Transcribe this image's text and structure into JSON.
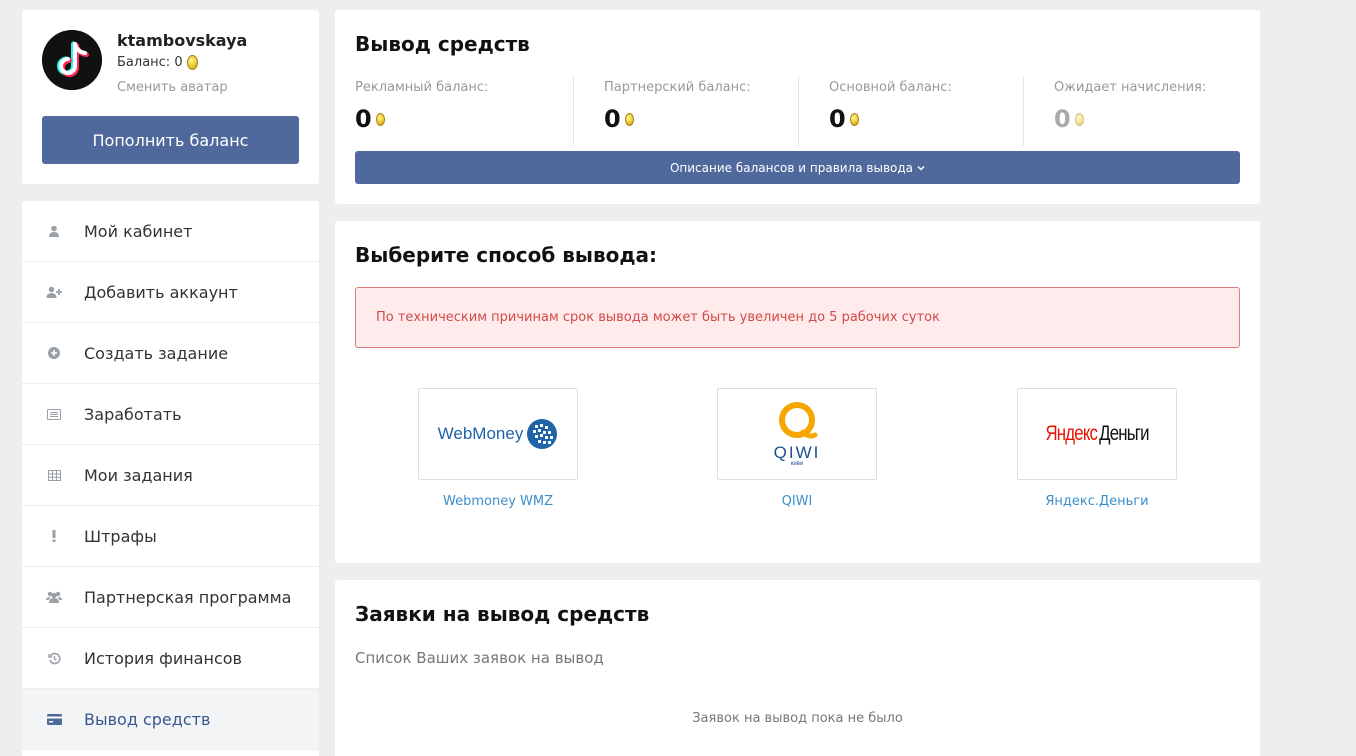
{
  "profile": {
    "username": "ktambovskaya",
    "balance_label": "Баланс: 0",
    "change_avatar": "Сменить аватар",
    "topup_button": "Пополнить баланс"
  },
  "menu": {
    "items": [
      {
        "label": "Мой кабинет",
        "icon": "user-icon"
      },
      {
        "label": "Добавить аккаунт",
        "icon": "user-plus-icon"
      },
      {
        "label": "Создать задание",
        "icon": "plus-circle-icon"
      },
      {
        "label": "Заработать",
        "icon": "list-icon"
      },
      {
        "label": "Мои задания",
        "icon": "table-icon"
      },
      {
        "label": "Штрафы",
        "icon": "exclamation-icon"
      },
      {
        "label": "Партнерская программа",
        "icon": "users-icon"
      },
      {
        "label": "История финансов",
        "icon": "history-icon"
      },
      {
        "label": "Вывод средств",
        "icon": "credit-card-icon"
      }
    ]
  },
  "withdraw": {
    "title": "Вывод средств",
    "balances": [
      {
        "label": "Рекламный баланс:",
        "value": "0"
      },
      {
        "label": "Партнерский баланс:",
        "value": "0"
      },
      {
        "label": "Основной баланс:",
        "value": "0"
      },
      {
        "label": "Ожидает начисления:",
        "value": "0"
      }
    ],
    "description_button": "Описание балансов и правила вывода"
  },
  "methods": {
    "title": "Выберите способ вывода:",
    "alert": "По техническим причинам срок вывода может быть увеличен до 5 рабочих суток",
    "items": [
      {
        "label": "Webmoney WMZ",
        "logo_text": "WebMoney"
      },
      {
        "label": "QIWI",
        "logo_text": "QIWI",
        "logo_sub": "киви"
      },
      {
        "label": "Яндекс.Деньги",
        "logo_text_a": "Яндекс",
        "logo_text_b": "Деньги"
      }
    ]
  },
  "requests": {
    "title": "Заявки на вывод средств",
    "subtitle": "Список Ваших заявок на вывод",
    "empty": "Заявок на вывод пока не было"
  },
  "colors": {
    "accent": "#50699c",
    "link": "#3a8fc9",
    "alert_bg": "#ffebeb",
    "alert_text": "#d24a4a"
  }
}
